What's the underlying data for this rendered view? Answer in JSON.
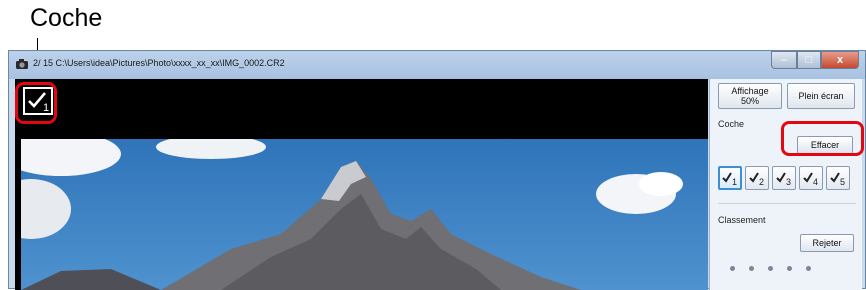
{
  "annotation": {
    "callout_label": "Coche"
  },
  "window": {
    "title": "2/ 15  C:\\Users\\idea\\Pictures\\Photo\\xxxx_xx_xx\\IMG_0002.CR2",
    "controls": {
      "minimize": "–",
      "maximize": "□",
      "close": "x"
    }
  },
  "viewer": {
    "check_mark_number": "1"
  },
  "panel": {
    "zoom_button_line1": "Affichage",
    "zoom_button_line2": "50%",
    "fullscreen_button": "Plein écran",
    "check_section_label": "Coche",
    "clear_button": "Effacer",
    "check_buttons": [
      "1",
      "2",
      "3",
      "4",
      "5"
    ],
    "active_check": 1,
    "rating_section_label": "Classement",
    "reject_button": "Rejeter",
    "rating_star_count": 5
  },
  "colors": {
    "highlight_ring": "#e30613",
    "active_check_border": "#3b8fd6"
  }
}
